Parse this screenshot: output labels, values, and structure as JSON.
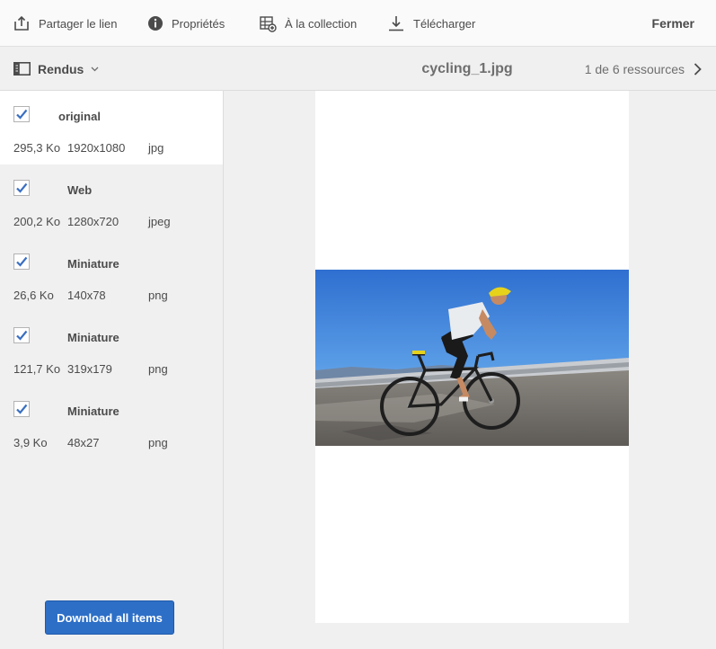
{
  "toolbar": {
    "share": "Partager le lien",
    "properties": "Propriétés",
    "collection": "À la collection",
    "download": "Télécharger",
    "close": "Fermer"
  },
  "subbar": {
    "renditions_label": "Rendus",
    "file_title": "cycling_1.jpg",
    "pager": "1 de 6 ressources"
  },
  "renditions": [
    {
      "name": "original",
      "size": "295,3 Ko",
      "dimensions": "1920x1080",
      "format": "jpg",
      "checked": true,
      "selected": true
    },
    {
      "name": "Web",
      "size": "200,2 Ko",
      "dimensions": "1280x720",
      "format": "jpeg",
      "checked": true,
      "selected": false
    },
    {
      "name": "Miniature",
      "size": "26,6 Ko",
      "dimensions": "140x78",
      "format": "png",
      "checked": true,
      "selected": false
    },
    {
      "name": "Miniature",
      "size": "121,7 Ko",
      "dimensions": "319x179",
      "format": "png",
      "checked": true,
      "selected": false
    },
    {
      "name": "Miniature",
      "size": "3,9 Ko",
      "dimensions": "48x27",
      "format": "png",
      "checked": true,
      "selected": false
    }
  ],
  "download_all_label": "Download all items",
  "colors": {
    "accent": "#2d6fc7",
    "checkbox": "#3a6fc2"
  },
  "icons": {
    "share": "share-icon",
    "properties": "info-icon",
    "collection": "add-to-collection-icon",
    "download": "download-icon",
    "renditions": "side-panel-icon",
    "chevron": "chevron-down-icon",
    "next": "chevron-right-icon"
  }
}
